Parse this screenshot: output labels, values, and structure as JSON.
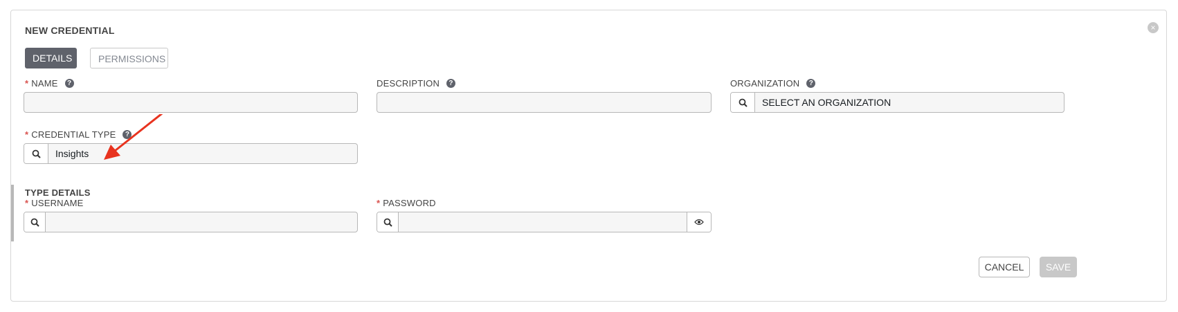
{
  "dialog": {
    "title": "NEW CREDENTIAL",
    "close_icon": "×"
  },
  "tabs": [
    {
      "label": "DETAILS",
      "active": true
    },
    {
      "label": "PERMISSIONS",
      "active": false
    }
  ],
  "fields": {
    "name": {
      "label": "NAME",
      "required": "*",
      "value": ""
    },
    "description": {
      "label": "DESCRIPTION",
      "value": ""
    },
    "organization": {
      "label": "ORGANIZATION",
      "value": "SELECT AN ORGANIZATION"
    },
    "credential_type": {
      "label": "CREDENTIAL TYPE",
      "required": "*",
      "value": "Insights"
    }
  },
  "type_details": {
    "title": "TYPE DETAILS",
    "username": {
      "label": "USERNAME",
      "required": "*",
      "value": ""
    },
    "password": {
      "label": "PASSWORD",
      "required": "*",
      "value": ""
    }
  },
  "buttons": {
    "cancel": "CANCEL",
    "save": "SAVE"
  },
  "help_icon": "?",
  "colors": {
    "accent": "#5f626b",
    "required": "#d9534f",
    "annotation_arrow": "#e8331f",
    "disabled": "#c8c8c8"
  }
}
